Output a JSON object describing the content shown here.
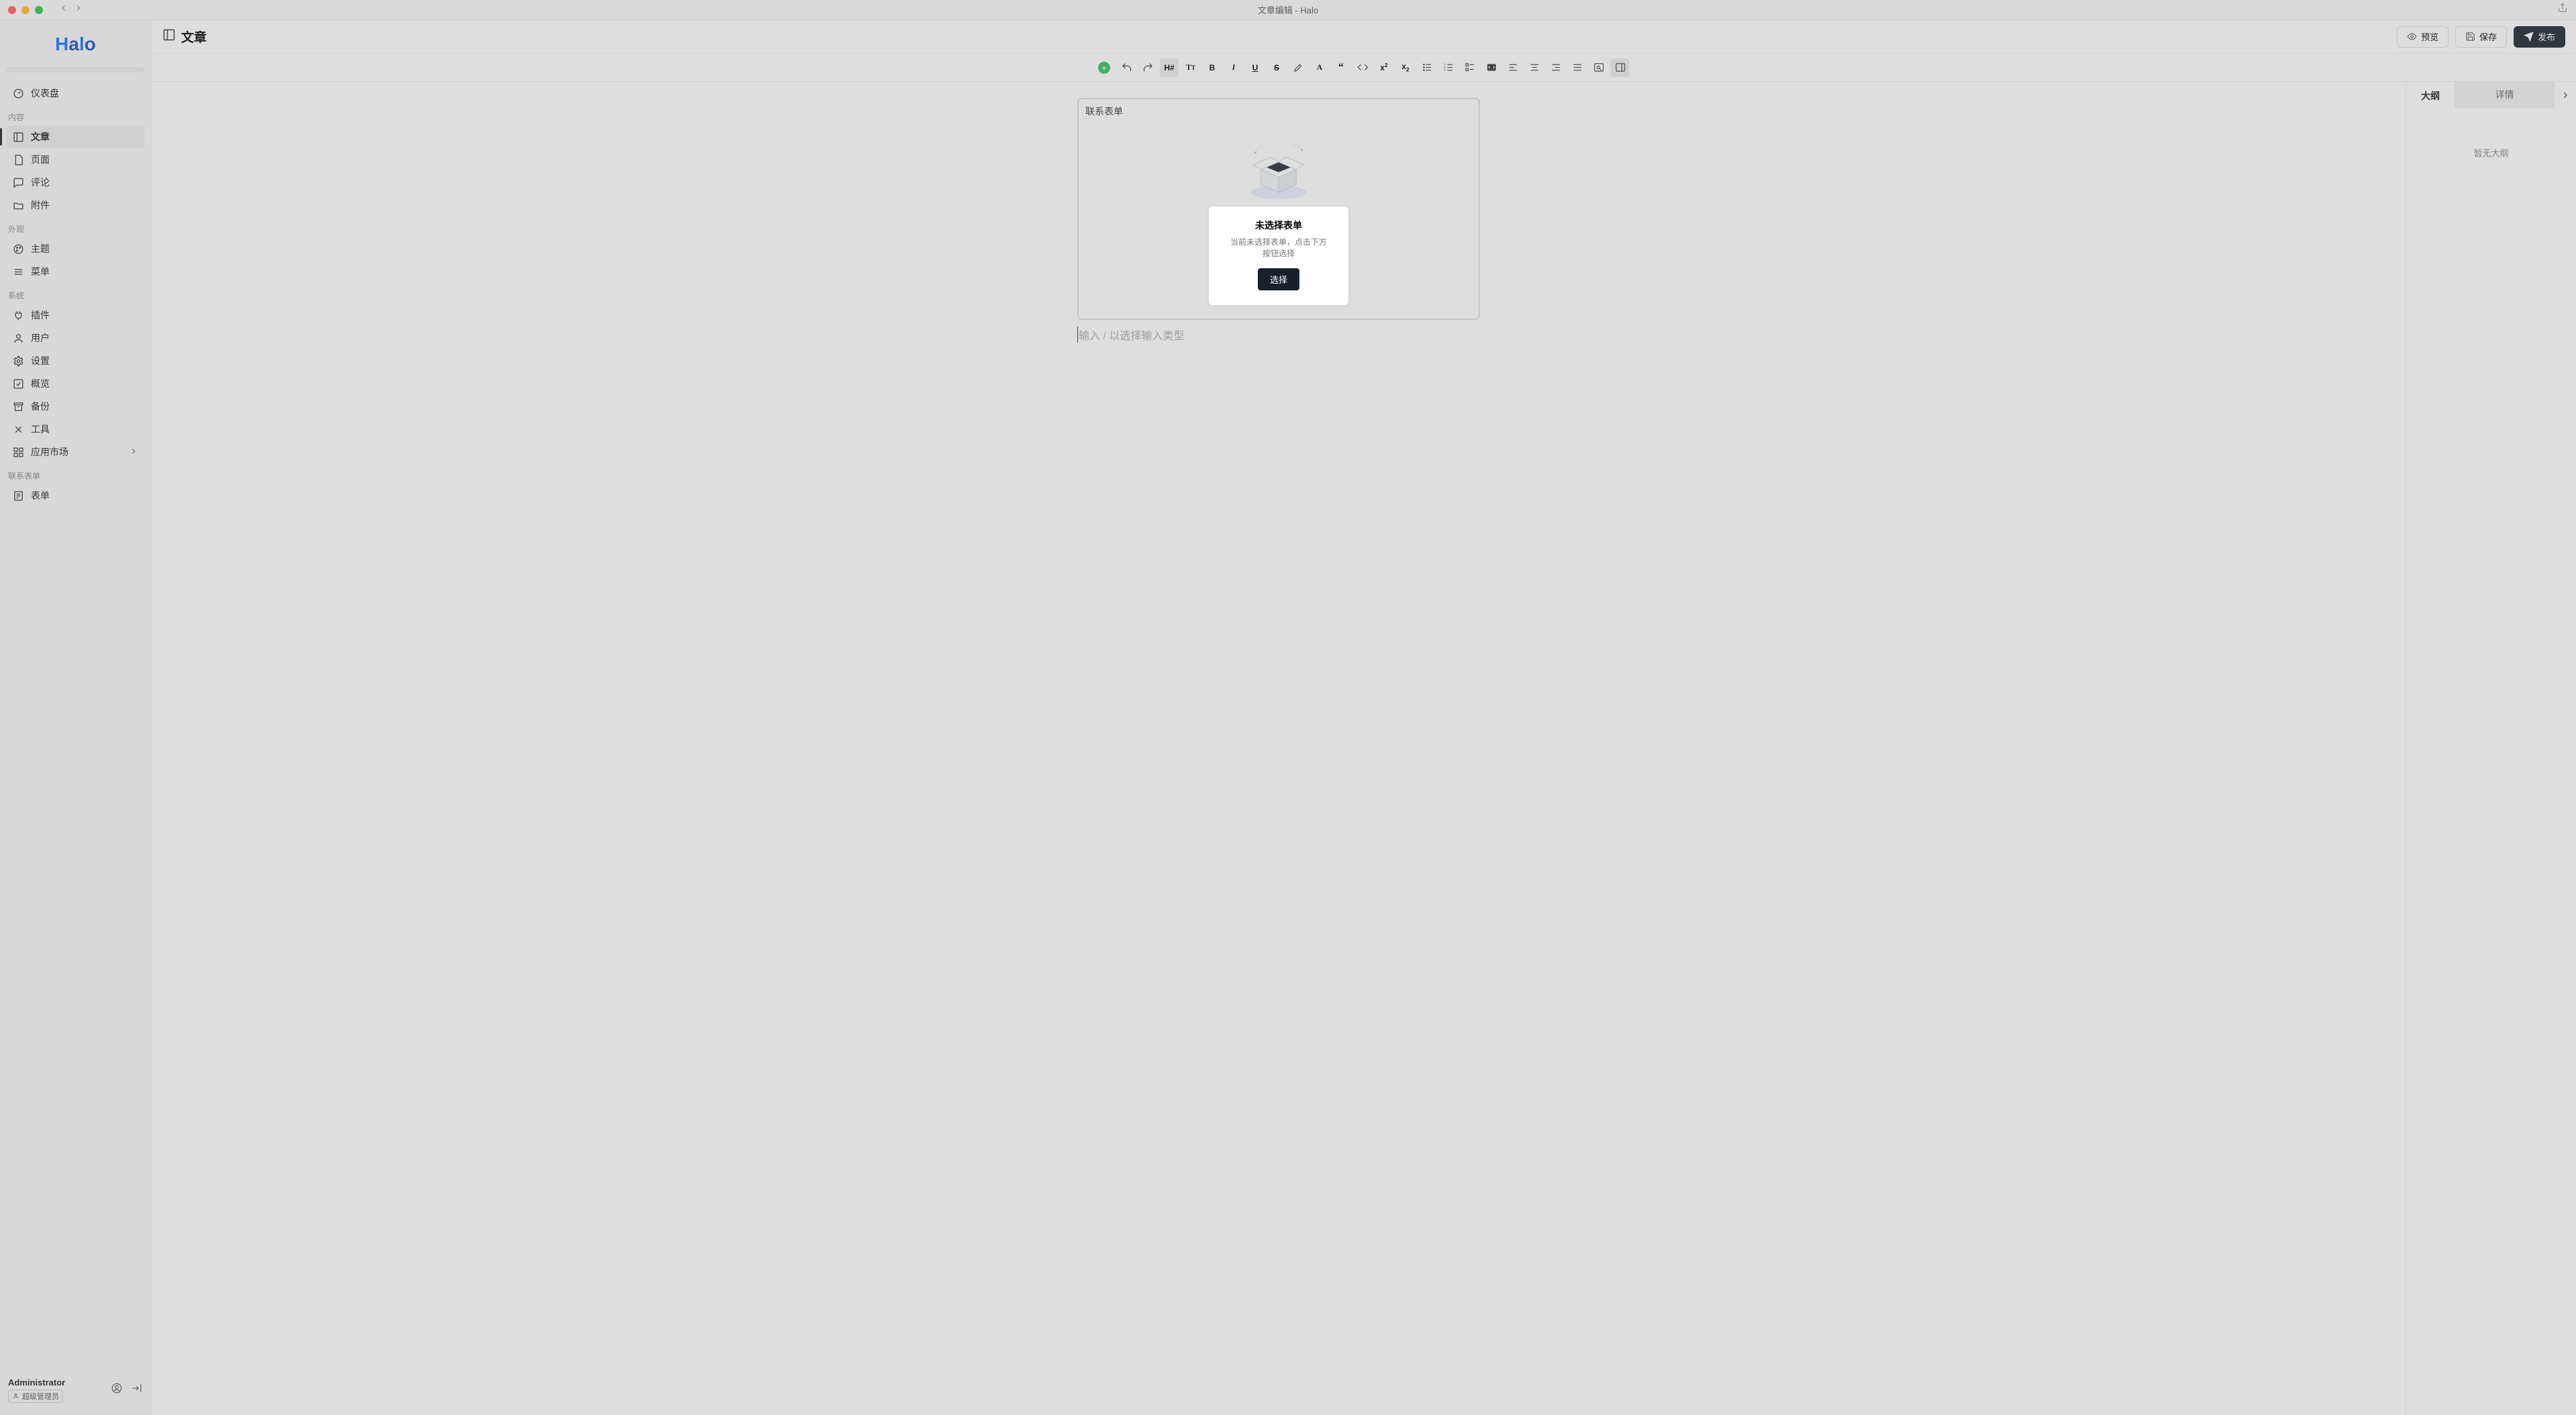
{
  "window": {
    "title": "文章编辑 - Halo"
  },
  "brand": {
    "name": "Halo"
  },
  "sidebar": {
    "top": {
      "dashboard": "仪表盘"
    },
    "sections": {
      "content": {
        "label": "内容",
        "items": {
          "posts": "文章",
          "pages": "页面",
          "comments": "评论",
          "attachments": "附件"
        }
      },
      "appearance": {
        "label": "外观",
        "items": {
          "themes": "主题",
          "menus": "菜单"
        }
      },
      "system": {
        "label": "系统",
        "items": {
          "plugins": "插件",
          "users": "用户",
          "settings": "设置",
          "overview": "概览",
          "backup": "备份",
          "tools": "工具",
          "market": "应用市场"
        }
      },
      "forms": {
        "label": "联系表单",
        "items": {
          "forms": "表单"
        }
      }
    },
    "footer": {
      "name": "Administrator",
      "role": "超级管理员"
    }
  },
  "header": {
    "title": "文章",
    "buttons": {
      "preview": "预览",
      "save": "保存",
      "publish": "发布"
    }
  },
  "editor": {
    "block_title": "联系表单",
    "empty": {
      "title": "未选择表单",
      "desc": "当前未选择表单，点击下方按钮选择",
      "button": "选择"
    },
    "placeholder": "输入 / 以选择输入类型"
  },
  "rightpanel": {
    "tabs": {
      "outline": "大纲",
      "detail": "详情"
    },
    "empty": "暂无大纲"
  }
}
